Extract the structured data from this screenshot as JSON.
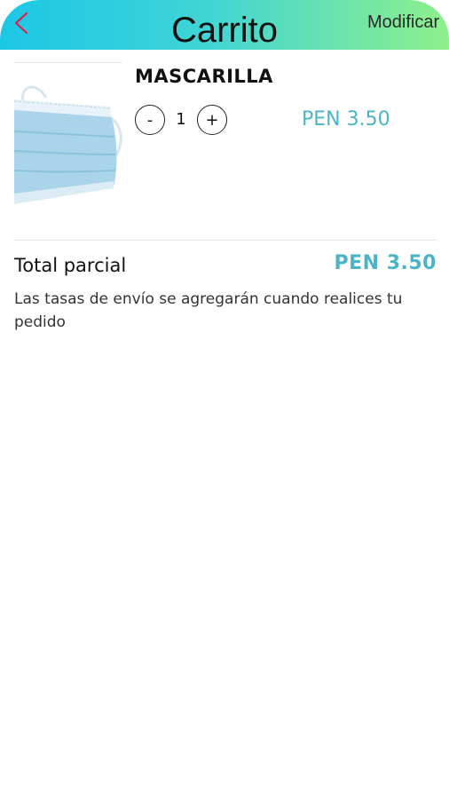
{
  "header": {
    "title": "Carrito",
    "modify_label": "Modificar",
    "back_icon": "chevron-left-icon",
    "gradient_start": "#1cc7e6",
    "gradient_end": "#8ef08a",
    "back_icon_color": "#e0204a"
  },
  "cart": {
    "items": [
      {
        "name": "MASCARILLA",
        "quantity": "1",
        "minus_label": "-",
        "plus_label": "+",
        "price": "PEN 3.50",
        "image_icon": "face-mask-image"
      }
    ]
  },
  "summary": {
    "subtotal_label": "Total parcial",
    "subtotal_value": "PEN 3.50",
    "shipping_note": "Las tasas de envío se agregarán cuando realices tu pedido"
  },
  "colors": {
    "accent": "#4bb5c8"
  }
}
